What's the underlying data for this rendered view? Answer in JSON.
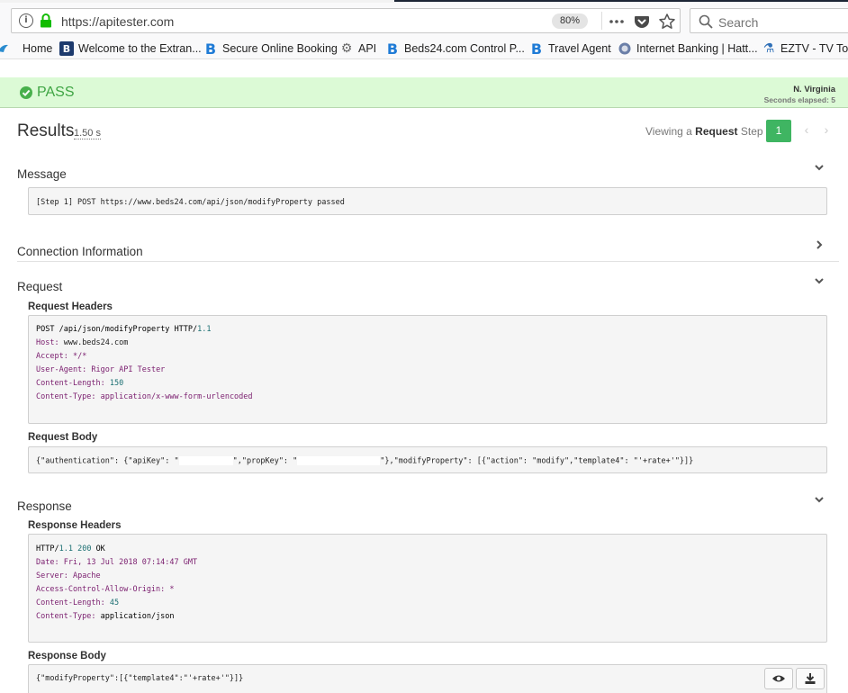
{
  "browser": {
    "url": "https://apitester.com",
    "zoom": "80%",
    "search_placeholder": "Search",
    "bookmarks": [
      {
        "label": "Home",
        "icon": "home-icon"
      },
      {
        "label": "Welcome to the Extran...",
        "icon": "b-dark-icon"
      },
      {
        "label": "Secure Online Booking",
        "icon": "b-blue-icon"
      },
      {
        "label": "API",
        "icon": "gear-icon"
      },
      {
        "label": "Beds24.com Control P...",
        "icon": "b-blue-icon"
      },
      {
        "label": "Travel Agent",
        "icon": "b-blue-icon"
      },
      {
        "label": "Internet Banking | Hatt...",
        "icon": "bank-icon"
      },
      {
        "label": "EZTV - TV Torr",
        "icon": "eztv-icon"
      }
    ]
  },
  "status": {
    "label": "PASS",
    "region": "N. Virginia",
    "elapsed": "Seconds elapsed: 5",
    "color": "#3fa544"
  },
  "results": {
    "title": "Results",
    "time": "1.50 s",
    "viewing_prefix": "Viewing a",
    "viewing_bold": "Request",
    "viewing_suffix": "Step",
    "step": "1"
  },
  "message": {
    "heading": "Message",
    "text": "[Step 1] POST https://www.beds24.com/api/json/modifyProperty passed"
  },
  "connection": {
    "heading": "Connection Information"
  },
  "request": {
    "heading": "Request",
    "headers_title": "Request Headers",
    "headers": {
      "request_line": {
        "method": "POST",
        "path": "/api/json/modifyProperty",
        "proto": "HTTP/",
        "version": "1.1"
      },
      "lines": [
        {
          "key": "Host:",
          "value": "www.beds24.com"
        },
        {
          "key": "Accept:",
          "value": "*/*"
        },
        {
          "key": "User-Agent:",
          "value": "Rigor API Tester"
        },
        {
          "key": "Content-Length:",
          "value": "150"
        },
        {
          "key": "Content-Type:",
          "value": "application/x-www-form-urlencoded"
        }
      ]
    },
    "body_title": "Request Body",
    "body_part1": "{\"authentication\": {\"apiKey\": \"",
    "body_part2": "\",\"propKey\": \"",
    "body_part3": "\"},\"modifyProperty\": [{\"action\": \"modify\",\"template4\": \"'+rate+'\"}]}"
  },
  "response": {
    "heading": "Response",
    "headers_title": "Response Headers",
    "status_line": {
      "proto": "HTTP/",
      "version": "1.1",
      "code": "200",
      "text": "OK"
    },
    "lines": [
      {
        "key": "Date:",
        "value": "Fri, 13 Jul 2018 07:14:47 GMT"
      },
      {
        "key": "Server:",
        "value": "Apache"
      },
      {
        "key": "Access-Control-Allow-Origin:",
        "value": "*"
      },
      {
        "key": "Content-Length:",
        "value": "45"
      },
      {
        "key": "Content-Type:",
        "value": "application/json"
      }
    ],
    "body_title": "Response Body",
    "body": "{\"modifyProperty\":[{\"template4\":\"'+rate+'\"}]}"
  }
}
